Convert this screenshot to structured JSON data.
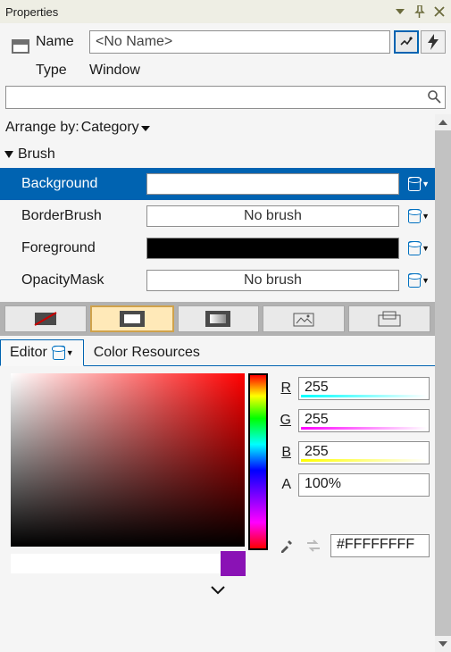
{
  "panel": {
    "title": "Properties"
  },
  "header": {
    "name_label": "Name",
    "name_value": "<No Name>",
    "type_label": "Type",
    "type_value": "Window"
  },
  "search": {
    "placeholder": ""
  },
  "arrange": {
    "prefix": "Arrange by:",
    "value": "Category"
  },
  "category": {
    "name": "Brush"
  },
  "brushes": [
    {
      "label": "Background",
      "kind": "solid-white",
      "display": "",
      "selected": true
    },
    {
      "label": "BorderBrush",
      "kind": "none",
      "display": "No brush",
      "selected": false
    },
    {
      "label": "Foreground",
      "kind": "solid-black",
      "display": "",
      "selected": false
    },
    {
      "label": "OpacityMask",
      "kind": "none",
      "display": "No brush",
      "selected": false
    }
  ],
  "brushTypes": {
    "items": [
      "no-brush",
      "solid",
      "gradient",
      "tile",
      "visual"
    ],
    "selected": 1
  },
  "tabs": {
    "editor": "Editor",
    "resources": "Color Resources",
    "active": "editor"
  },
  "rgba": {
    "r_label": "R",
    "r": "255",
    "g_label": "G",
    "g": "255",
    "b_label": "B",
    "b": "255",
    "a_label": "A",
    "a": "100%"
  },
  "colors": {
    "hex": "#FFFFFFFF",
    "previous": "#8a12b5",
    "current": "#ffffff"
  }
}
